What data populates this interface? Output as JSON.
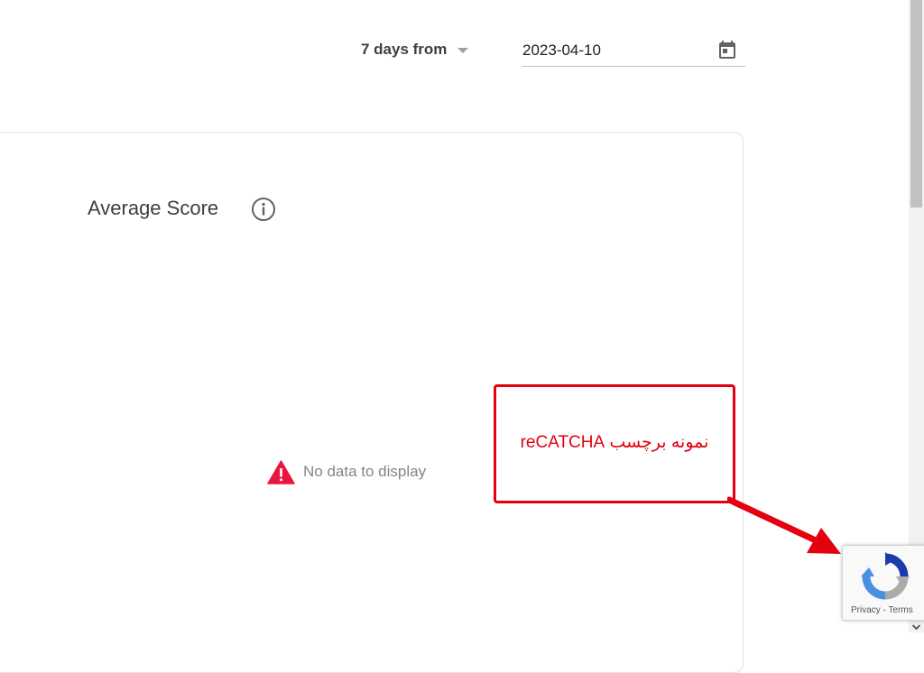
{
  "toolbar": {
    "range_label": "7 days from",
    "date_value": "2023-04-10"
  },
  "card": {
    "title": "Average Score",
    "empty_message": "No data to display"
  },
  "callout": {
    "text": "نمونه برچسب reCATCHA"
  },
  "recaptcha": {
    "privacy_label": "Privacy",
    "separator": " - ",
    "terms_label": "Terms"
  },
  "colors": {
    "warning": "#e8173d",
    "callout_red": "#e3000f",
    "recaptcha_blue": "#1c3aa9",
    "recaptcha_lightblue": "#4a90e2",
    "recaptcha_gray": "#ababab"
  },
  "icons": {
    "calendar": "calendar-icon",
    "info": "info-icon",
    "warning": "warning-icon",
    "recaptcha": "recaptcha-logo-icon"
  }
}
